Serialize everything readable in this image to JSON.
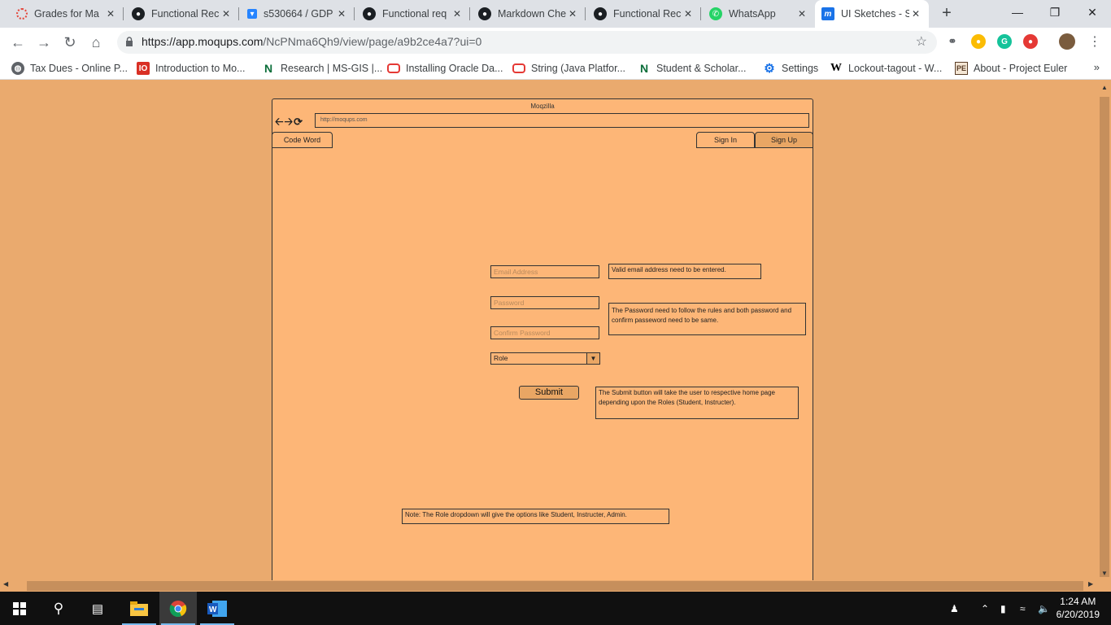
{
  "browser": {
    "tabs": [
      {
        "title": "Grades for Ma",
        "icon": "canvas-icon",
        "active": false
      },
      {
        "title": "Functional Rec",
        "icon": "github-icon",
        "active": false
      },
      {
        "title": "s530664 / GDP",
        "icon": "bitbucket-icon",
        "active": false
      },
      {
        "title": "Functional req",
        "icon": "github-icon",
        "active": false
      },
      {
        "title": "Markdown Che",
        "icon": "github-icon",
        "active": false
      },
      {
        "title": "Functional Rec",
        "icon": "github-icon",
        "active": false
      },
      {
        "title": "WhatsApp",
        "icon": "whatsapp-icon",
        "active": false
      },
      {
        "title": "UI Sketches - S",
        "icon": "moqups-icon",
        "active": true
      }
    ],
    "address": {
      "host": "https://app.moqups.com",
      "path": "/NcPNma6Qh9/view/page/a9b2ce4a7?ui=0"
    },
    "bookmarks": [
      {
        "label": "Tax Dues - Online P...",
        "icon": "globe-icon"
      },
      {
        "label": "Introduction to Mo...",
        "icon": "io-icon"
      },
      {
        "label": "Research | MS-GIS |...",
        "icon": "n-icon"
      },
      {
        "label": "Installing Oracle Da...",
        "icon": "oracle-icon"
      },
      {
        "label": "String (Java Platfor...",
        "icon": "oracle-icon"
      },
      {
        "label": "Student & Scholar...",
        "icon": "n-icon"
      },
      {
        "label": "Settings",
        "icon": "gear-icon"
      },
      {
        "label": "Lockout-tagout - W...",
        "icon": "wikipedia-icon"
      },
      {
        "label": "About - Project Euler",
        "icon": "pe-icon"
      }
    ],
    "bookmarks_more": "»"
  },
  "mockup": {
    "window_title": "Moqzilla",
    "url": "http://moqups.com",
    "code_word_button": "Code Word",
    "sign_in_button": "Sign In",
    "sign_up_button": "Sign Up",
    "email_placeholder": "Email Address",
    "password_placeholder": "Password",
    "confirm_password_placeholder": "Confirm Password",
    "role_select": "Role",
    "submit_button": "Submit",
    "note_email": "Valid email address need to be entered.",
    "note_password": "The Password need to follow the rules and both password and confirm passeword need to be same.",
    "note_submit": "The Submit button will take the user to respective home page depending upon the Roles (Student, Instructer).",
    "note_role": "Note: The Role dropdown will give the options like Student, Instructer, Admin."
  },
  "taskbar": {
    "time": "1:24 AM",
    "date": "6/20/2019"
  },
  "colors": {
    "page_bg": "#eaaa6e",
    "mockup_bg": "#fdb677",
    "accent_blue": "#1a73e8"
  }
}
